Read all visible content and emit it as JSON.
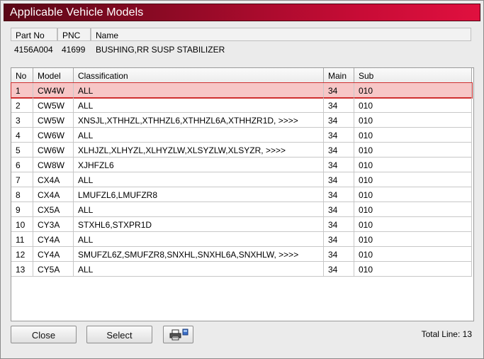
{
  "window": {
    "title": "Applicable Vehicle Models"
  },
  "part": {
    "headers": {
      "part_no": "Part No",
      "pnc": "PNC",
      "name": "Name"
    },
    "values": {
      "part_no": "4156A004",
      "pnc": "41699",
      "name": "BUSHING,RR SUSP STABILIZER"
    }
  },
  "grid": {
    "columns": {
      "no": "No",
      "model": "Model",
      "classification": "Classification",
      "main": "Main",
      "sub": "Sub"
    },
    "rows": [
      {
        "no": "1",
        "model": "CW4W",
        "classification": "ALL",
        "main": "34",
        "sub": "010"
      },
      {
        "no": "2",
        "model": "CW5W",
        "classification": "ALL",
        "main": "34",
        "sub": "010"
      },
      {
        "no": "3",
        "model": "CW5W",
        "classification": "XNSJL,XTHHZL,XTHHZL6,XTHHZL6A,XTHHZR1D,  >>>>",
        "main": "34",
        "sub": "010"
      },
      {
        "no": "4",
        "model": "CW6W",
        "classification": "ALL",
        "main": "34",
        "sub": "010"
      },
      {
        "no": "5",
        "model": "CW6W",
        "classification": "XLHJZL,XLHYZL,XLHYZLW,XLSYZLW,XLSYZR,  >>>>",
        "main": "34",
        "sub": "010"
      },
      {
        "no": "6",
        "model": "CW8W",
        "classification": "XJHFZL6",
        "main": "34",
        "sub": "010"
      },
      {
        "no": "7",
        "model": "CX4A",
        "classification": "ALL",
        "main": "34",
        "sub": "010"
      },
      {
        "no": "8",
        "model": "CX4A",
        "classification": "LMUFZL6,LMUFZR8",
        "main": "34",
        "sub": "010"
      },
      {
        "no": "9",
        "model": "CX5A",
        "classification": "ALL",
        "main": "34",
        "sub": "010"
      },
      {
        "no": "10",
        "model": "CY3A",
        "classification": "STXHL6,STXPR1D",
        "main": "34",
        "sub": "010"
      },
      {
        "no": "11",
        "model": "CY4A",
        "classification": "ALL",
        "main": "34",
        "sub": "010"
      },
      {
        "no": "12",
        "model": "CY4A",
        "classification": "SMUFZL6Z,SMUFZR8,SNXHL,SNXHL6A,SNXHLW,  >>>>",
        "main": "34",
        "sub": "010"
      },
      {
        "no": "13",
        "model": "CY5A",
        "classification": "ALL",
        "main": "34",
        "sub": "010"
      }
    ],
    "selected_row": "1"
  },
  "footer": {
    "close_label": "Close",
    "select_label": "Select",
    "print_icon": "printer-icon",
    "total_text": "Total Line: 13"
  },
  "colors": {
    "title_gradient_start": "#5a0716",
    "title_gradient_end": "#e0103f",
    "selection_fill": "#f7c6c6",
    "selection_border": "#cf2f2f"
  }
}
